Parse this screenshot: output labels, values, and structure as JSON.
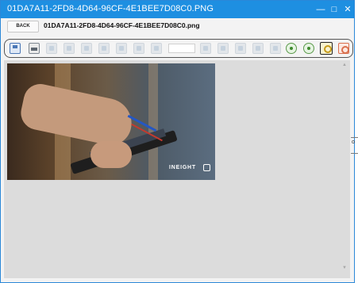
{
  "window": {
    "title": "01DA7A11-2FD8-4D64-96CF-4E1BEE7D08C0.PNG",
    "minimize_glyph": "—",
    "maximize_glyph": "□",
    "close_glyph": "✕"
  },
  "header": {
    "back_label": "BACK",
    "file_name": "01DA7A11-2FD8-4D64-96CF-4E1BEE7D08C0.png"
  },
  "toolbar": {
    "buttons": [
      {
        "icon": "save-icon",
        "enabled": true
      },
      {
        "icon": "print-icon",
        "enabled": true
      },
      {
        "icon": "single-page-icon",
        "enabled": false
      },
      {
        "icon": "two-page-icon",
        "enabled": false
      },
      {
        "icon": "fit-width-icon",
        "enabled": false
      },
      {
        "icon": "fit-page-icon",
        "enabled": false
      },
      {
        "icon": "refresh-icon",
        "enabled": false
      },
      {
        "icon": "first-page-icon",
        "enabled": false
      },
      {
        "icon": "previous-page-icon",
        "enabled": false
      },
      {
        "icon": "next-page-icon",
        "enabled": false
      },
      {
        "icon": "last-page-icon",
        "enabled": false
      },
      {
        "icon": "select-tool-icon",
        "enabled": false
      },
      {
        "icon": "crop-icon",
        "enabled": false
      },
      {
        "icon": "annotate-icon",
        "enabled": false
      },
      {
        "icon": "rotate-left-icon",
        "enabled": true
      },
      {
        "icon": "rotate-right-icon",
        "enabled": true
      },
      {
        "icon": "zoom-in-icon",
        "enabled": true,
        "selected": true
      },
      {
        "icon": "zoom-out-icon",
        "enabled": true
      }
    ],
    "page_value": ""
  },
  "image": {
    "watermark": "INEIGHT"
  },
  "scroll": {
    "up_glyph": "▲",
    "down_glyph": "▼"
  },
  "edge": {
    "glyph": "o"
  }
}
